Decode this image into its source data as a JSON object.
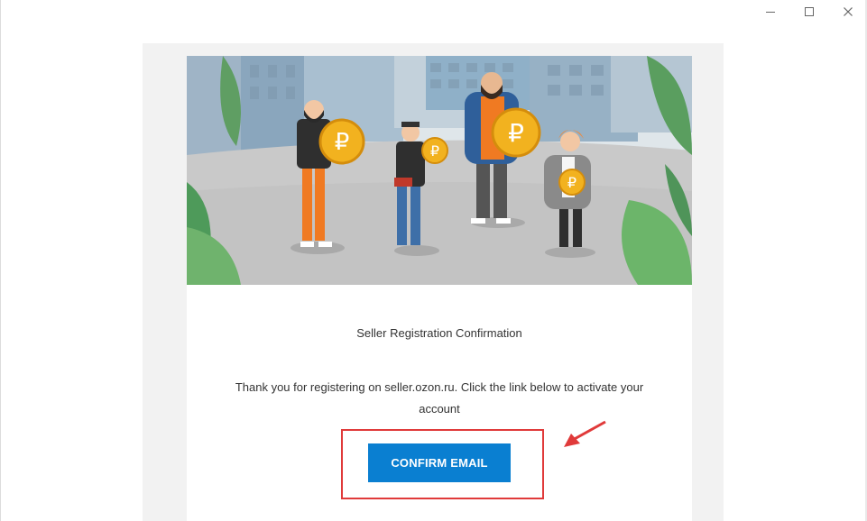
{
  "window": {
    "controls": {
      "minimize": "minimize-icon",
      "maximize": "maximize-icon",
      "close": "close-icon"
    }
  },
  "email": {
    "heading": "Seller Registration Confirmation",
    "body": "Thank you for registering on seller.ozon.ru. Click the link below to activate your account",
    "confirm_button": "CONFIRM EMAIL"
  },
  "annotation": {
    "color": "#e03a3a",
    "arrow_icon": "red-arrow-icon"
  },
  "colors": {
    "button": "#0a7fd1",
    "coin": "#f2b21f"
  }
}
